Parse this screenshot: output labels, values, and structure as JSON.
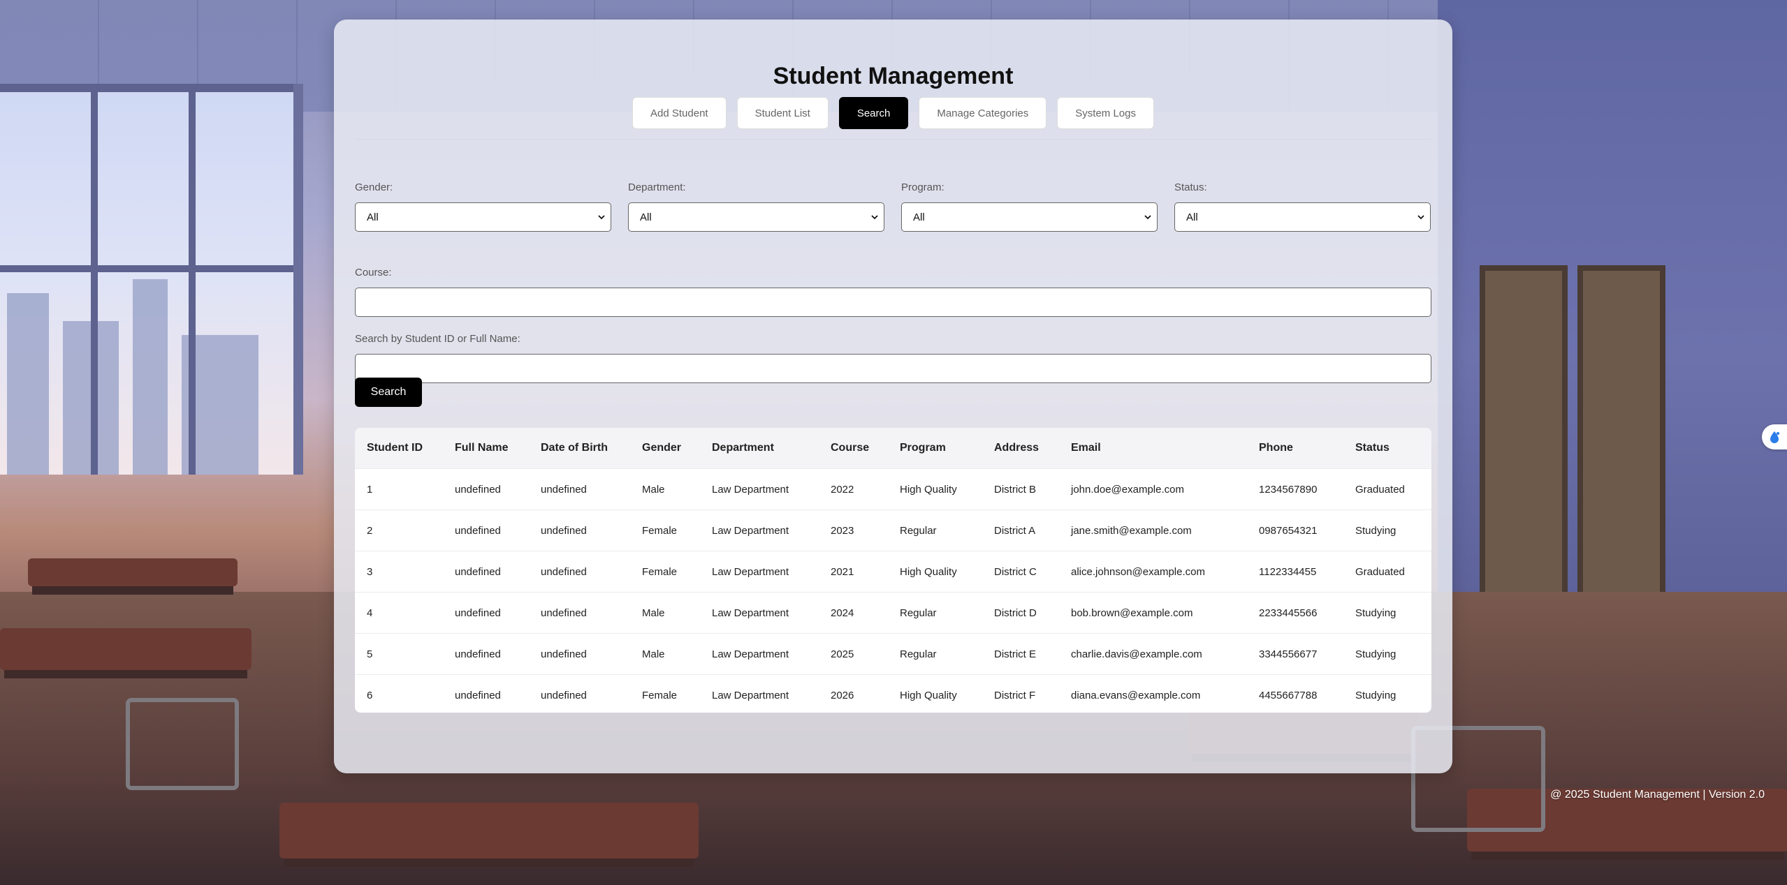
{
  "app": {
    "title": "Student Management"
  },
  "tabs": [
    {
      "label": "Add Student",
      "active": false
    },
    {
      "label": "Student List",
      "active": false
    },
    {
      "label": "Search",
      "active": true
    },
    {
      "label": "Manage Categories",
      "active": false
    },
    {
      "label": "System Logs",
      "active": false
    }
  ],
  "filters": {
    "gender": {
      "label": "Gender:",
      "value": "All"
    },
    "department": {
      "label": "Department:",
      "value": "All"
    },
    "program": {
      "label": "Program:",
      "value": "All"
    },
    "status": {
      "label": "Status:",
      "value": "All"
    }
  },
  "course": {
    "label": "Course:",
    "value": ""
  },
  "search": {
    "label": "Search by Student ID or Full Name:",
    "value": "",
    "button_label": "Search"
  },
  "table": {
    "columns": [
      "Student ID",
      "Full Name",
      "Date of Birth",
      "Gender",
      "Department",
      "Course",
      "Program",
      "Address",
      "Email",
      "Phone",
      "Status"
    ],
    "rows": [
      [
        "1",
        "undefined",
        "undefined",
        "Male",
        "Law Department",
        "2022",
        "High Quality",
        "District B",
        "john.doe@example.com",
        "1234567890",
        "Graduated"
      ],
      [
        "2",
        "undefined",
        "undefined",
        "Female",
        "Law Department",
        "2023",
        "Regular",
        "District A",
        "jane.smith@example.com",
        "0987654321",
        "Studying"
      ],
      [
        "3",
        "undefined",
        "undefined",
        "Female",
        "Law Department",
        "2021",
        "High Quality",
        "District C",
        "alice.johnson@example.com",
        "1122334455",
        "Graduated"
      ],
      [
        "4",
        "undefined",
        "undefined",
        "Male",
        "Law Department",
        "2024",
        "Regular",
        "District D",
        "bob.brown@example.com",
        "2233445566",
        "Studying"
      ],
      [
        "5",
        "undefined",
        "undefined",
        "Male",
        "Law Department",
        "2025",
        "Regular",
        "District E",
        "charlie.davis@example.com",
        "3344556677",
        "Studying"
      ],
      [
        "6",
        "undefined",
        "undefined",
        "Female",
        "Law Department",
        "2026",
        "High Quality",
        "District F",
        "diana.evans@example.com",
        "4455667788",
        "Studying"
      ]
    ]
  },
  "footer": {
    "text": "@ 2025 Student Management | Version 2.0"
  },
  "colors": {
    "accent": "#000000",
    "panel": "#e8eaf2",
    "side_widget_icon": "#2b7de9"
  },
  "icons": {
    "select_arrow": "chevron-down-icon",
    "side_widget": "assistant-icon"
  }
}
